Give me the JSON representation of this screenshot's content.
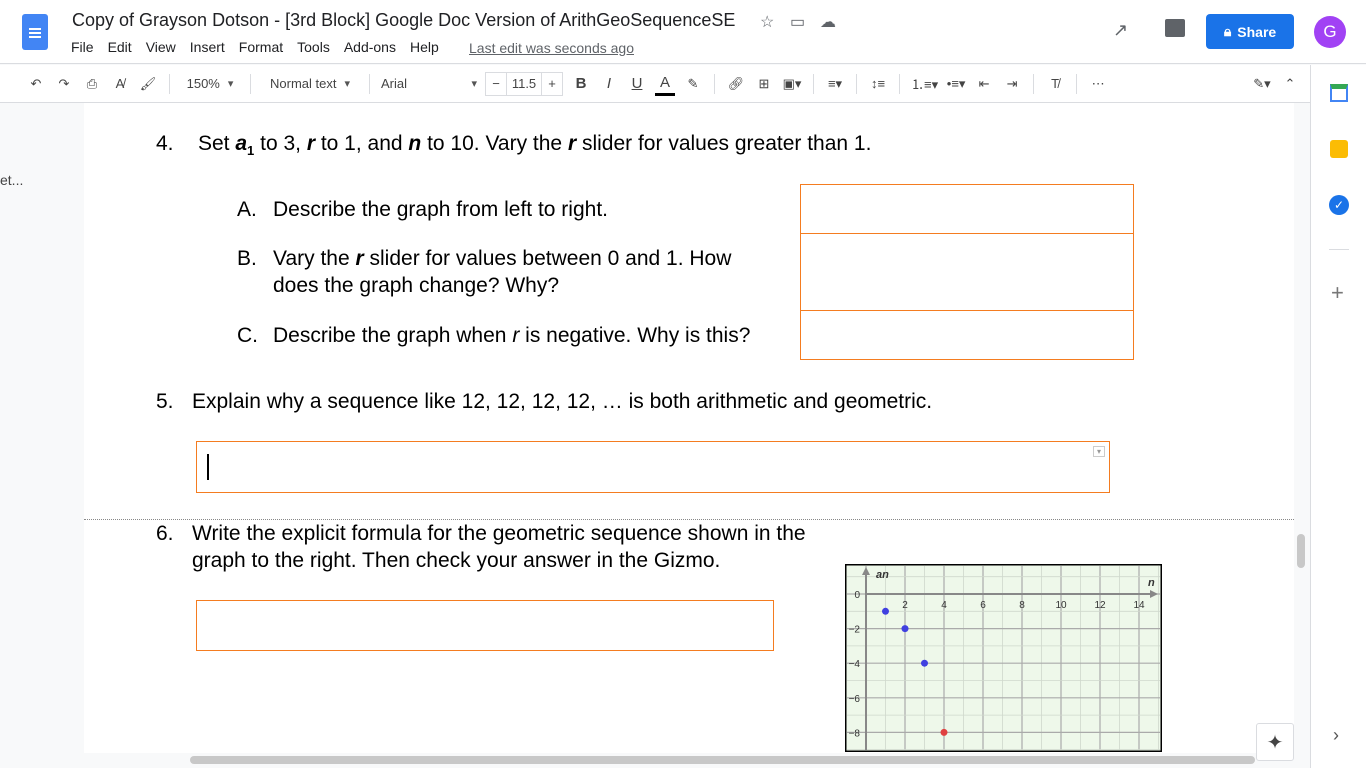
{
  "header": {
    "title": "Copy of Grayson Dotson - [3rd Block] Google Doc Version of ArithGeoSequenceSE",
    "menu": [
      "File",
      "Edit",
      "View",
      "Insert",
      "Format",
      "Tools",
      "Add-ons",
      "Help"
    ],
    "last_edit": "Last edit was seconds ago",
    "share_label": "Share",
    "avatar_letter": "G"
  },
  "toolbar": {
    "zoom": "150%",
    "style": "Normal text",
    "font": "Arial",
    "font_size": "11.5",
    "minus": "−",
    "plus": "+",
    "bold": "B",
    "italic": "I",
    "underline": "U",
    "text_color": "A",
    "more": "⋯"
  },
  "left_stub": "et...",
  "document": {
    "q4": {
      "num": "4.",
      "text_parts": [
        "Set ",
        "a",
        "1",
        " to 3, ",
        "r",
        " to 1, and ",
        "n",
        " to 10. Vary the ",
        "r",
        " slider for values greater than 1."
      ],
      "a": {
        "label": "A.",
        "text": "Describe the graph from left to right."
      },
      "b": {
        "label": "B.",
        "pre": "Vary the ",
        "r": "r",
        "post": " slider for values between 0 and 1. How",
        "line2": "does the graph change? Why?"
      },
      "c": {
        "label": "C.",
        "pre": "Describe the graph when ",
        "r": "r",
        "post": " is negative. Why is this?"
      }
    },
    "q5": {
      "num": "5.",
      "text": "Explain why a sequence like 12, 12, 12, 12, … is both arithmetic and geometric."
    },
    "q6": {
      "num": "6.",
      "line1": "Write the explicit formula for the geometric sequence shown in the",
      "line2": "graph to the right. Then check your answer in the Gizmo."
    }
  },
  "chart_data": {
    "type": "scatter",
    "xlabel": "n",
    "ylabel": "a_n",
    "xlim": [
      0,
      15
    ],
    "ylim": [
      -9,
      1
    ],
    "x_ticks": [
      2,
      4,
      6,
      8,
      10,
      12,
      14
    ],
    "y_ticks": [
      0,
      -2,
      -4,
      -6,
      -8
    ],
    "grid": true,
    "points": [
      {
        "x": 1,
        "y": -1,
        "color": "#4040e0"
      },
      {
        "x": 2,
        "y": -2,
        "color": "#4040e0"
      },
      {
        "x": 3,
        "y": -4,
        "color": "#4040e0"
      },
      {
        "x": 4,
        "y": -8,
        "color": "#e04040"
      }
    ]
  },
  "colors": {
    "accent": "#1a73e8",
    "box_border": "#f47c20",
    "grid_bg": "#eef8ea"
  }
}
